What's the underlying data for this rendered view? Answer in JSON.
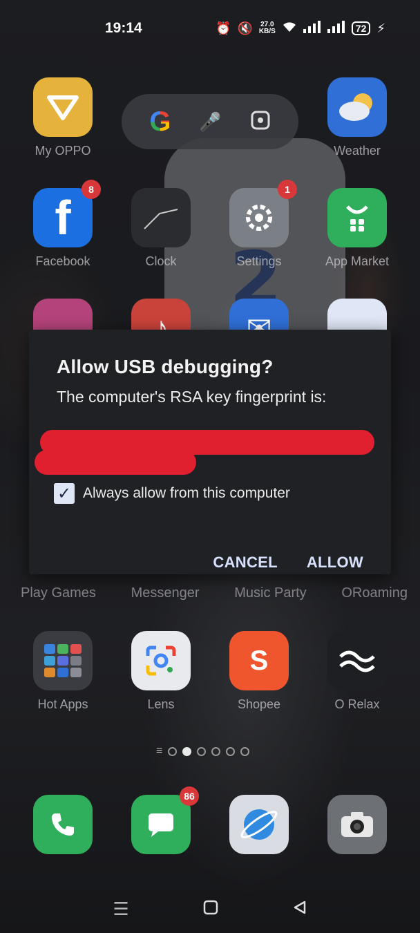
{
  "status_bar": {
    "time": "19:14",
    "net_speed_value": "27.0",
    "net_speed_unit": "KB/S",
    "battery": "72"
  },
  "apps": {
    "row1": [
      {
        "label": "My OPPO",
        "color": "#e5b23b"
      },
      {
        "label": "Weather",
        "color": "#2f6fd6"
      }
    ],
    "row2": [
      {
        "label": "Facebook",
        "color": "#1b6fe0",
        "badge": "8"
      },
      {
        "label": "Clock",
        "color": "#2b2c30"
      },
      {
        "label": "Settings",
        "color": "#7b7f86",
        "badge": "1"
      },
      {
        "label": "App Market",
        "color": "#2fae5c"
      }
    ],
    "row4_labels": [
      "Play Games",
      "Messenger",
      "Music Party",
      "ORoaming"
    ],
    "row5": [
      {
        "label": "Hot Apps",
        "color": "#3a3c42"
      },
      {
        "label": "Lens",
        "color": "#e9eaed"
      },
      {
        "label": "Shopee",
        "color": "#f0562e"
      },
      {
        "label": "O Relax",
        "color": "#1e1f22"
      }
    ],
    "dock": [
      {
        "label": "Phone",
        "color": "#2fae5c"
      },
      {
        "label": "Messages",
        "color": "#2fae5c",
        "badge": "86"
      },
      {
        "label": "Browser",
        "color": "#d9dde3"
      },
      {
        "label": "Camera",
        "color": "#6d7075"
      }
    ]
  },
  "dialog": {
    "title": "Allow USB debugging?",
    "message": "The computer's RSA key fingerprint is:",
    "checkbox_label": "Always allow from this computer",
    "checkbox_checked": true,
    "cancel": "CANCEL",
    "allow": "ALLOW"
  }
}
